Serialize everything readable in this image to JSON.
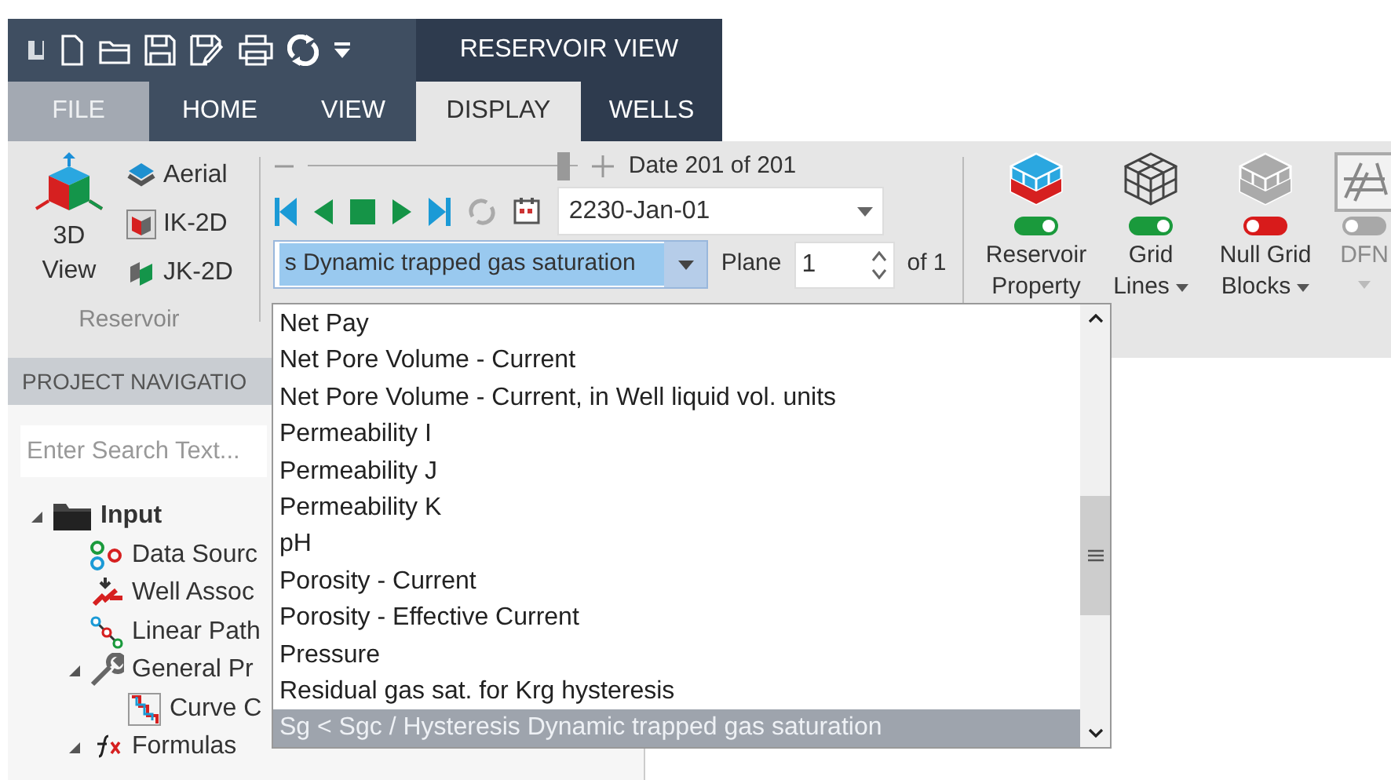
{
  "title_bar": {
    "title": "RESERVOIR VIEW"
  },
  "tabs": [
    {
      "label": "FILE",
      "kind": "file",
      "selected": false
    },
    {
      "label": "HOME",
      "kind": "tab",
      "selected": false
    },
    {
      "label": "VIEW",
      "kind": "tab",
      "selected": false
    },
    {
      "label": "DISPLAY",
      "kind": "tab",
      "selected": true
    },
    {
      "label": "WELLS",
      "kind": "tab",
      "selected": false
    }
  ],
  "ribbon": {
    "reservoir_group": {
      "label": "Reservoir",
      "main_button": "3D View",
      "small_buttons": [
        {
          "label": "Aerial",
          "kind": "aerial"
        },
        {
          "label": "IK-2D",
          "kind": "ik"
        },
        {
          "label": "JK-2D",
          "kind": "jk"
        }
      ]
    },
    "time_group": {
      "slider": {
        "level": 0.97
      },
      "date_label": "Date 201 of 201",
      "date_value": "2230-Jan-01",
      "property_value": "s Dynamic trapped gas saturation",
      "plane_label": "Plane",
      "plane_value": "1",
      "plane_of": "of 1"
    },
    "display_buttons": [
      {
        "label": "Reservoir Property",
        "kind": "color-cube",
        "on": true,
        "disabled": false,
        "menu": false
      },
      {
        "label": "Grid Lines",
        "kind": "wire-cube",
        "on": true,
        "disabled": false,
        "menu": true
      },
      {
        "label": "Null Grid Blocks",
        "kind": "grey-cube",
        "on": false,
        "disabled": false,
        "menu": true
      },
      {
        "label": "DFN",
        "kind": "fracture",
        "on": false,
        "disabled": true,
        "menu": true
      }
    ]
  },
  "navigator": {
    "title": "PROJECT NAVIGATIO",
    "search_placeholder": "Enter Search Text...",
    "tree": [
      {
        "label": "Input",
        "kind": "folder",
        "expanded": true,
        "children": [
          {
            "label": "Data Sourc",
            "kind": "data-source"
          },
          {
            "label": "Well Assoc",
            "kind": "well-link"
          },
          {
            "label": "Linear Path",
            "kind": "linear-path"
          },
          {
            "label": "General Pr",
            "kind": "wrench",
            "expanded": true,
            "children": [
              {
                "label": "Curve C",
                "kind": "curve"
              }
            ]
          },
          {
            "label": "Formulas",
            "kind": "formula",
            "expanded": true
          }
        ]
      }
    ]
  },
  "property_list": {
    "items": [
      {
        "label": "Net Pay",
        "selected": false
      },
      {
        "label": "Net Pore Volume - Current",
        "selected": false
      },
      {
        "label": "Net Pore Volume - Current, in Well liquid vol. units",
        "selected": false
      },
      {
        "label": "Permeability I",
        "selected": false
      },
      {
        "label": "Permeability J",
        "selected": false
      },
      {
        "label": "Permeability K",
        "selected": false
      },
      {
        "label": "pH",
        "selected": false
      },
      {
        "label": "Porosity - Current",
        "selected": false
      },
      {
        "label": "Porosity - Effective Current",
        "selected": false
      },
      {
        "label": "Pressure",
        "selected": false
      },
      {
        "label": "Residual gas sat. for Krg hysteresis",
        "selected": false
      },
      {
        "label": "Sg < Sgc / Hysteresis Dynamic trapped gas saturation",
        "selected": true
      }
    ]
  }
}
